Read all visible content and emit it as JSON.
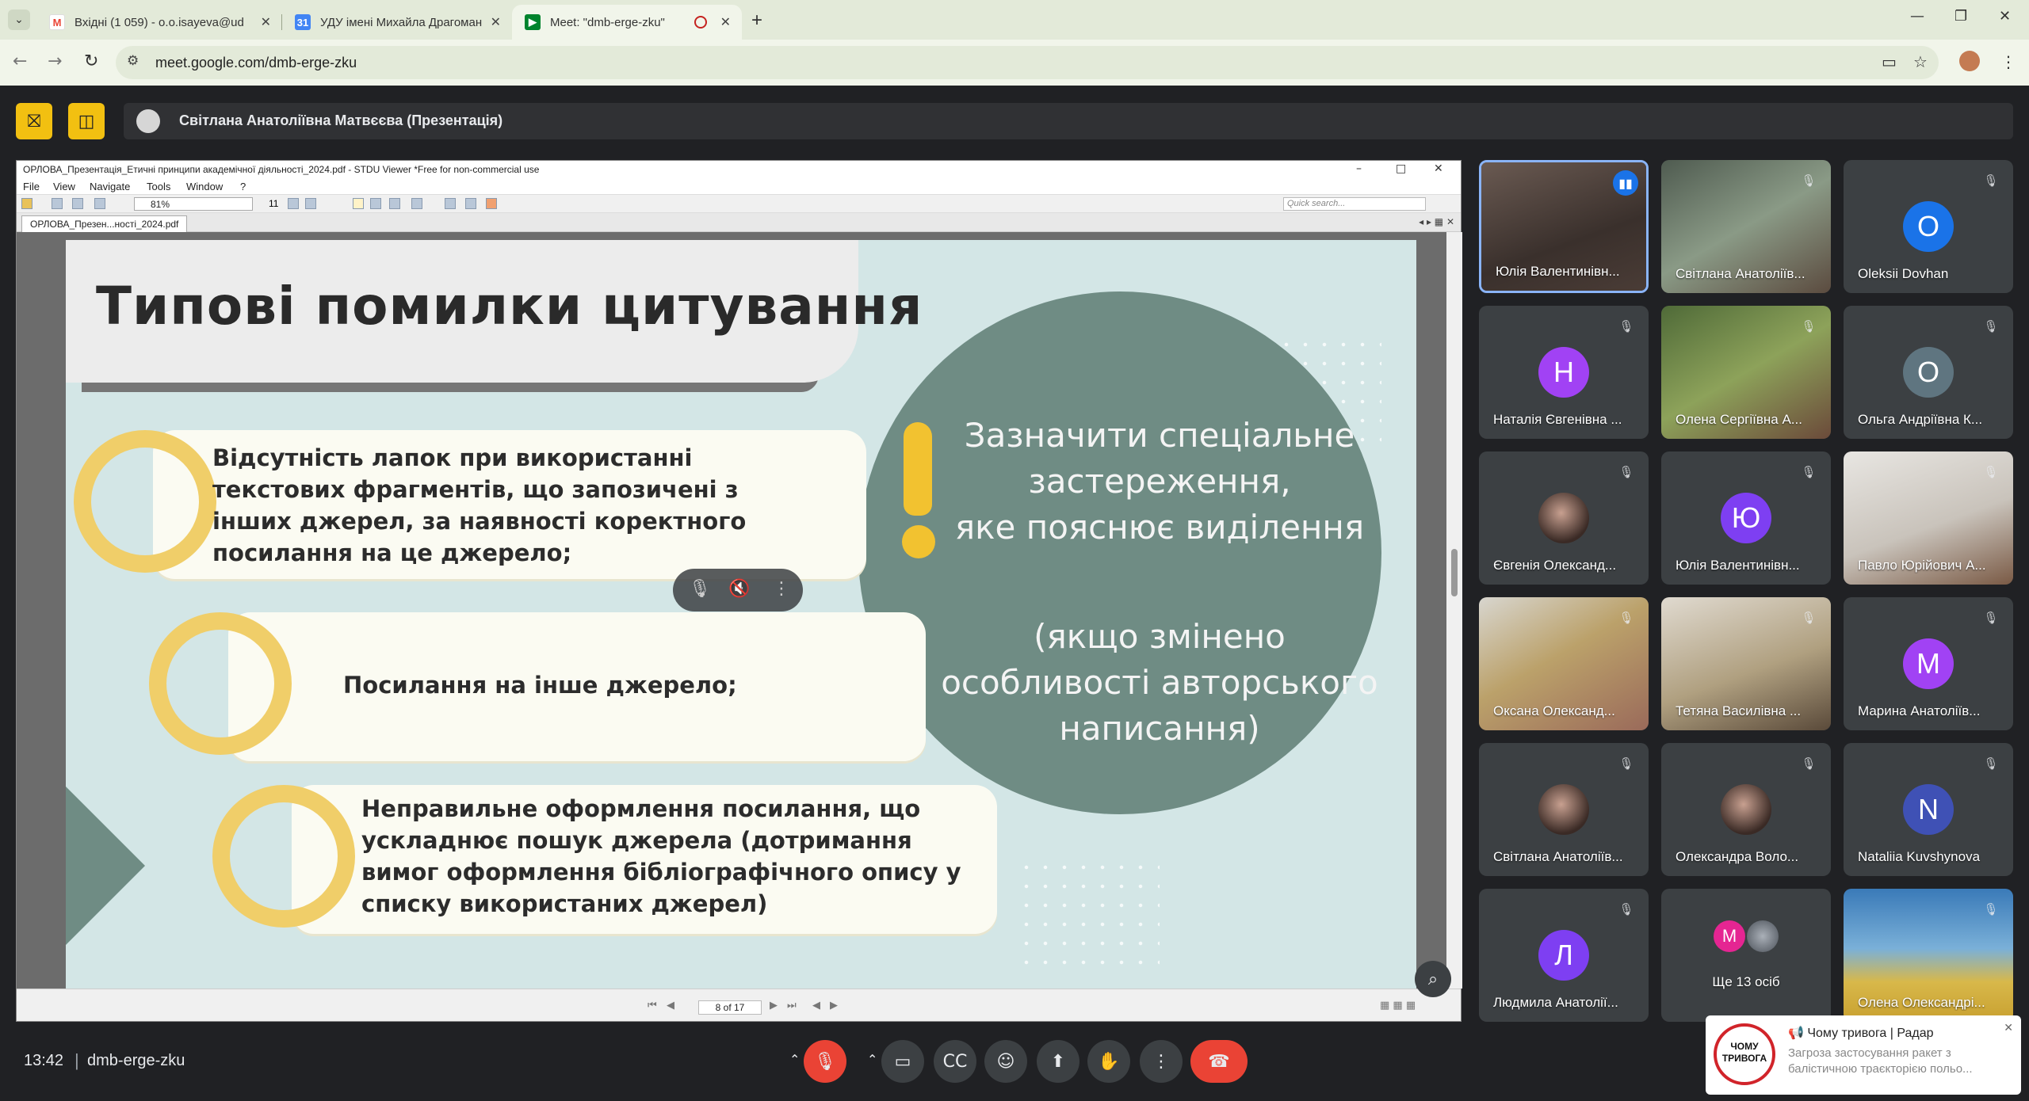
{
  "browser": {
    "tabs": [
      {
        "title": "Вхідні (1 059) - o.o.isayeva@ud",
        "favicon": "gmail-icon"
      },
      {
        "title": "УДУ імені Михайла Драгоман",
        "favicon": "calendar-icon"
      },
      {
        "title": "Meet: \"dmb-erge-zku\"",
        "favicon": "meet-icon"
      }
    ],
    "url": "meet.google.com/dmb-erge-zku"
  },
  "meet": {
    "presenter": "Світлана Анатоліївна Матвєєва (Презентація)",
    "time": "13:42",
    "code": "dmb-erge-zku"
  },
  "stdu": {
    "window_title": "ОРЛОВА_Презентація_Етичні принципи академічної діяльності_2024.pdf - STDU Viewer *Free for non-commercial use",
    "menu": [
      "File",
      "View",
      "Navigate",
      "Tools",
      "Window",
      "?"
    ],
    "zoom": "81%",
    "page_num": "11",
    "search_placeholder": "Quick search...",
    "doc_tab": "ОРЛОВА_Презен...ності_2024.pdf",
    "page_indicator": "8 of 17"
  },
  "slide": {
    "title": "Типові помилки цитування",
    "item1": "Відсутність лапок при використанні текстових фрагментів, що запозичені з інших джерел, за наявності коректного посилання на це джерело;",
    "item2": "Посилання на інше джерело;",
    "item3": "Неправильне оформлення посилання, що ускладнює пошук джерела (дотримання вимог оформлення бібліографічного опису у списку використаних джерел)",
    "circle_line1": "Зазначити спеціальне застереження,",
    "circle_line2": "яке пояснює виділення",
    "circle_line3": "(якщо змінено особливості авторського написання)"
  },
  "participants": [
    {
      "name": "Юлія Валентинівн...",
      "type": "photo",
      "speaking": true
    },
    {
      "name": "Світлана Анатоліїв...",
      "type": "photo"
    },
    {
      "name": "Oleksii Dovhan",
      "type": "avatar",
      "letter": "O",
      "color": "#1a73e8"
    },
    {
      "name": "Наталія Євгенівна ...",
      "type": "avatar",
      "letter": "Н",
      "color": "#a142f4"
    },
    {
      "name": "Олена Сергіївна А...",
      "type": "photo"
    },
    {
      "name": "Ольга Андріївна К...",
      "type": "avatar",
      "letter": "О",
      "color": "#5f7580"
    },
    {
      "name": "Євгенія Олександ...",
      "type": "photo-avatar"
    },
    {
      "name": "Юлія Валентинівн...",
      "type": "avatar",
      "letter": "Ю",
      "color": "#7e3ff2"
    },
    {
      "name": "Павло Юрійович А...",
      "type": "photo"
    },
    {
      "name": "Оксана Олександ...",
      "type": "photo"
    },
    {
      "name": "Тетяна Василівна ...",
      "type": "photo"
    },
    {
      "name": "Марина Анатоліїв...",
      "type": "avatar",
      "letter": "М",
      "color": "#a142f4"
    },
    {
      "name": "Світлана Анатоліїв...",
      "type": "photo-avatar"
    },
    {
      "name": "Олександра Воло...",
      "type": "photo-avatar"
    },
    {
      "name": "Nataliia Kuvshynova",
      "type": "avatar",
      "letter": "N",
      "color": "#3f51b5"
    },
    {
      "name": "Людмила Анатолії...",
      "type": "avatar",
      "letter": "Л",
      "color": "#7e3ff2"
    },
    {
      "name": "Ще 13 осіб",
      "type": "more",
      "letter": "М"
    },
    {
      "name": "Олена Олександрі...",
      "type": "photo"
    }
  ],
  "notification": {
    "logo": "ЧОМУ ТРИВОГА",
    "title": "📢 Чому тривога | Радар",
    "body": "Загроза застосування ракет з балістичною траєкторією польо..."
  }
}
